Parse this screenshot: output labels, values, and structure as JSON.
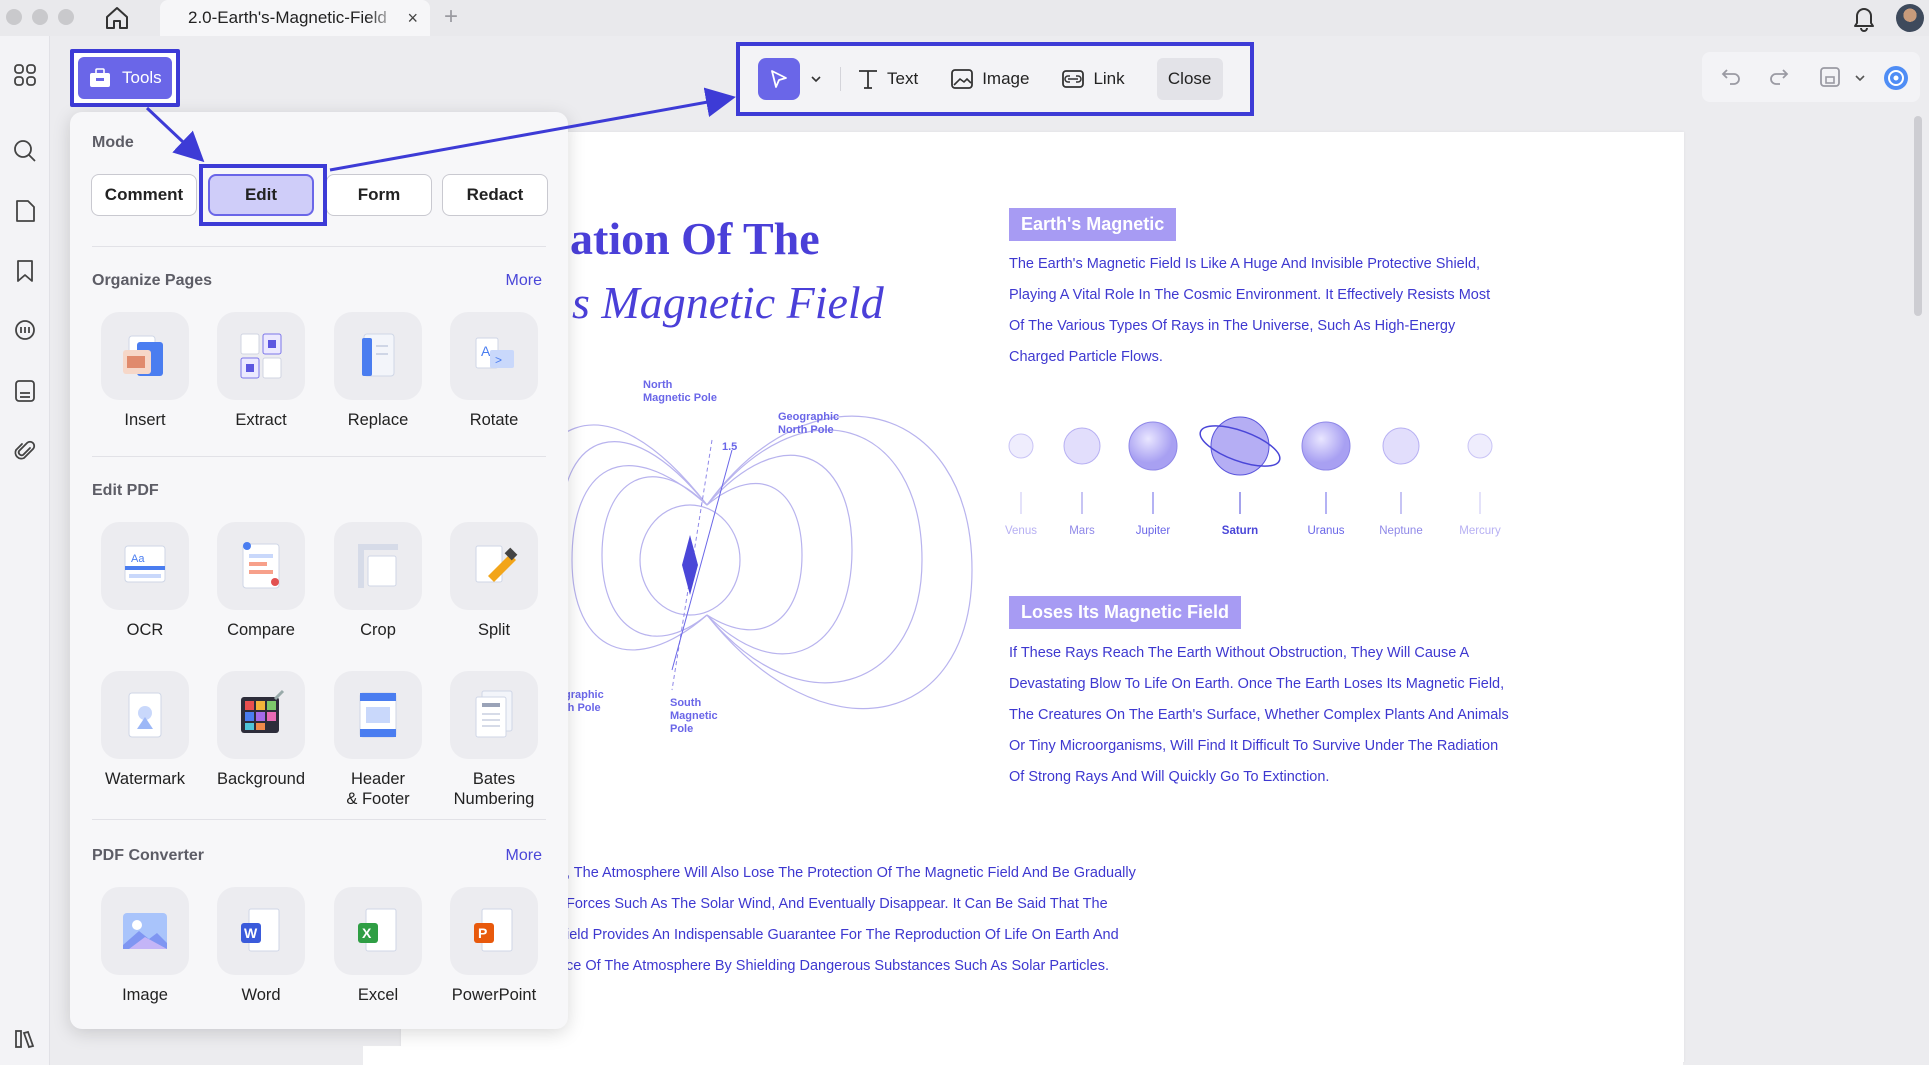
{
  "titlebar": {
    "tab_title": "2.0-Earth's-Magnetic-Field",
    "tab_close": "×",
    "tab_add": "+"
  },
  "toolbar": {
    "tools_label": "Tools",
    "text_label": "Text",
    "image_label": "Image",
    "link_label": "Link",
    "close_label": "Close"
  },
  "panel": {
    "mode_heading": "Mode",
    "modes": [
      "Comment",
      "Edit",
      "Form",
      "Redact"
    ],
    "active_mode": "Edit",
    "organize_heading": "Organize Pages",
    "organize_more": "More",
    "organize_tools": [
      "Insert",
      "Extract",
      "Replace",
      "Rotate"
    ],
    "edit_heading": "Edit PDF",
    "edit_tools_row1": [
      "OCR",
      "Compare",
      "Crop",
      "Split"
    ],
    "edit_tools_row2": [
      "Watermark",
      "Background",
      "Header\n& Footer",
      "Bates\nNumbering"
    ],
    "converter_heading": "PDF Converter",
    "converter_more": "More",
    "converter_tools": [
      "Image",
      "Word",
      "Excel",
      "PowerPoint"
    ]
  },
  "document": {
    "title_line1": "ation Of The",
    "title_line2": "s Magnetic Field",
    "section1_heading": "Earth's Magnetic",
    "section1_text": "The Earth's Magnetic Field Is Like A Huge And Invisible Protective Shield, Playing A Vital Role In The Cosmic Environment. It Effectively Resists Most Of The Various Types Of Rays in The Universe, Such As High-Energy Charged Particle Flows.",
    "planets": [
      "Venus",
      "Mars",
      "Jupiter",
      "Saturn",
      "Uranus",
      "Neptune",
      "Mercury"
    ],
    "section2_heading": "Loses Its Magnetic Field",
    "section2_text": "If These Rays Reach The Earth Without Obstruction, They Will Cause A Devastating Blow To Life On Earth. Once The Earth Loses Its Magnetic Field, The Creatures On The Earth's Surface, Whether Complex Plants And Animals Or Tiny Microorganisms, Will Find It Difficult To Survive Under The Radiation Of Strong Rays And Will Quickly Go To Extinction.",
    "bottom_lines": [
      ", The Atmosphere Will Also Lose The Protection Of The Magnetic Field And Be Gradually",
      "Forces Such As The Solar Wind, And Eventually Disappear. It Can Be Said That The",
      "ield Provides An Indispensable Guarantee For The Reproduction Of Life On Earth And",
      "ce Of The Atmosphere By Shielding Dangerous Substances Such As Solar Particles."
    ],
    "diagram_labels": {
      "north_magnetic": "North\nMagnetic Pole",
      "geo_north": "Geographic\nNorth Pole",
      "angle": "1.5",
      "geo_south": "graphic\nth Pole",
      "south_magnetic": "South\nMagnetic\nPole"
    }
  },
  "colors": {
    "accent": "#6a66e8",
    "highlight": "#3d3bd6",
    "doc_text": "#3e38d0",
    "section_bg": "#a79bf3"
  }
}
